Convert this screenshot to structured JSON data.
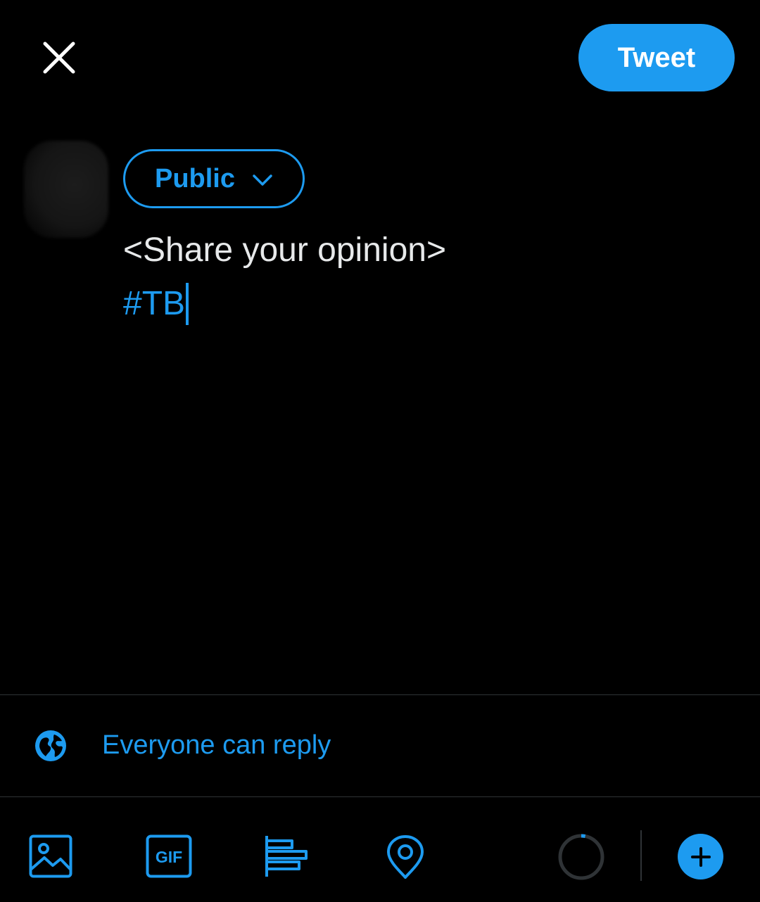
{
  "header": {
    "close_icon": "close-icon",
    "tweet_label": "Tweet"
  },
  "audience": {
    "label": "Public",
    "icon": "chevron-down-icon"
  },
  "compose": {
    "line1": "<Share your opinion>",
    "line2": "#TB"
  },
  "reply_settings": {
    "icon": "globe-icon",
    "label": "Everyone can reply"
  },
  "toolbar": {
    "items": [
      "image-icon",
      "gif-icon",
      "poll-icon",
      "location-icon"
    ],
    "char_counter_icon": "character-counter-ring",
    "add_icon": "plus-icon",
    "char_counter_progress": 0.03
  },
  "colors": {
    "accent": "#1d9bf0",
    "background": "#000000",
    "text": "#e7e9ea",
    "divider": "#2f3336"
  }
}
